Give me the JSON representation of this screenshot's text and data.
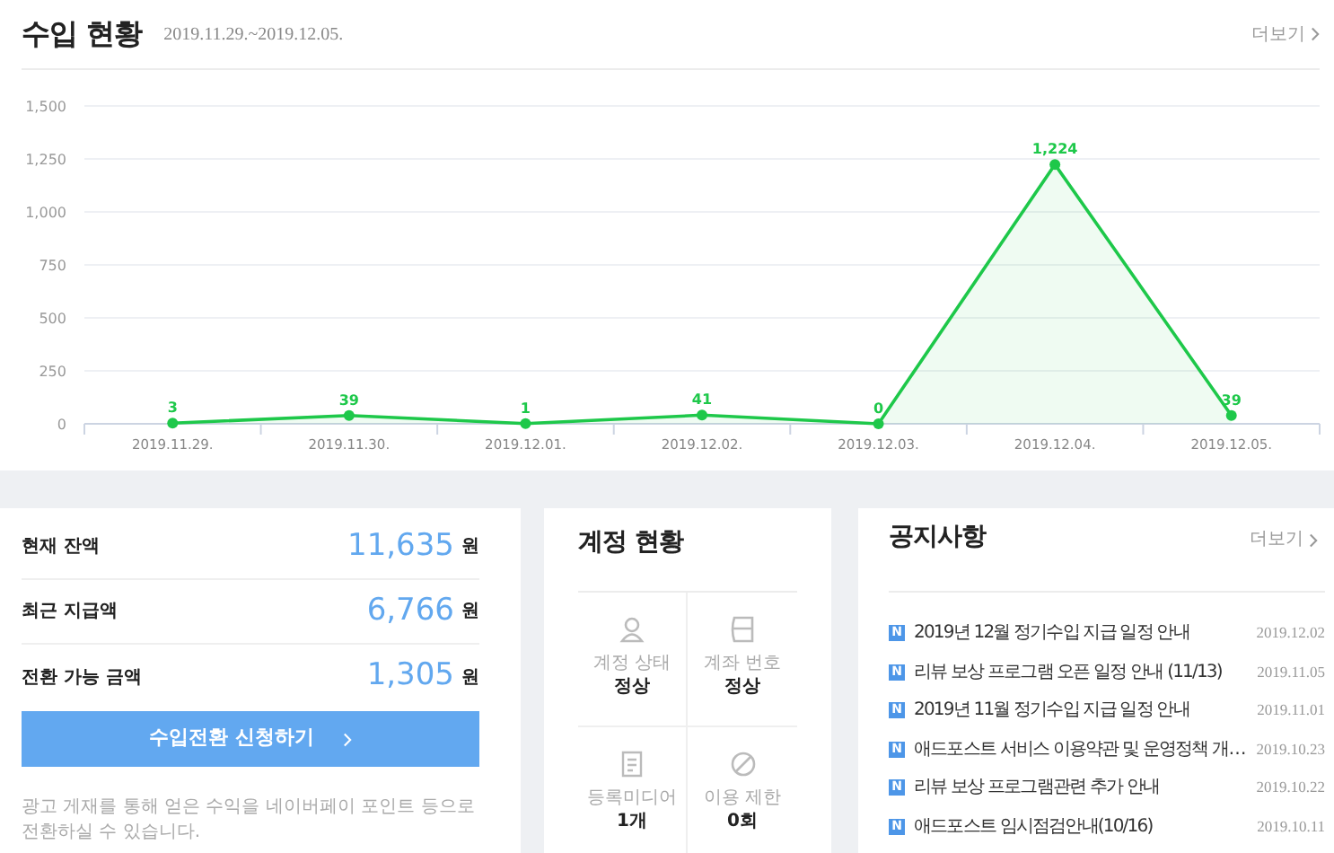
{
  "header": {
    "title": "수입 현황",
    "period": "2019.11.29.~2019.12.05.",
    "more": "더보기"
  },
  "chart_data": {
    "type": "area",
    "categories": [
      "2019.11.29.",
      "2019.11.30.",
      "2019.12.01.",
      "2019.12.02.",
      "2019.12.03.",
      "2019.12.04.",
      "2019.12.05."
    ],
    "series": [
      {
        "color": "#1ec84a",
        "values": [
          3,
          39,
          1,
          41,
          0,
          1224,
          39
        ]
      }
    ],
    "ylim": [
      0,
      1500
    ],
    "yticks": [
      {
        "value": 0,
        "label": "0"
      },
      {
        "value": 250,
        "label": "250"
      },
      {
        "value": 500,
        "label": "500"
      },
      {
        "value": 750,
        "label": "750"
      },
      {
        "value": 1000,
        "label": "1,000"
      },
      {
        "value": 1250,
        "label": "1,250"
      },
      {
        "value": 1500,
        "label": "1,500"
      }
    ],
    "value_labels": [
      "3",
      "39",
      "1",
      "41",
      "0",
      "1,224",
      "39"
    ],
    "grid": true
  },
  "balance": {
    "rows": [
      {
        "label": "현재 잔액",
        "amount": "11,635",
        "unit": "원"
      },
      {
        "label": "최근 지급액",
        "amount": "6,766",
        "unit": "원"
      },
      {
        "label": "전환 가능 금액",
        "amount": "1,305",
        "unit": "원"
      }
    ],
    "button": "수입전환 신청하기",
    "note": "광고 게재를 통해 얻은 수익을 네이버페이 포인트 등으로 전환하실 수 있습니다."
  },
  "account": {
    "title": "계정 현황",
    "items": [
      {
        "kind": "person",
        "label": "계정 상태",
        "value": "정상"
      },
      {
        "kind": "card",
        "label": "계좌 번호",
        "value": "정상"
      },
      {
        "kind": "document",
        "label": "등록미디어",
        "value": "1개"
      },
      {
        "kind": "ban",
        "label": "이용 제한",
        "value": "0회"
      }
    ]
  },
  "notices": {
    "title": "공지사항",
    "more": "더보기",
    "items": [
      {
        "badge": "N",
        "title": "2019년 12월 정기수입 지급 일정 안내",
        "date": "2019.12.02"
      },
      {
        "badge": "N",
        "title": "리뷰 보상 프로그램 오픈 일정 안내 (11/13)",
        "date": "2019.11.05"
      },
      {
        "badge": "N",
        "title": "2019년 11월 정기수입 지급 일정 안내",
        "date": "2019.11.01"
      },
      {
        "badge": "N",
        "title": "애드포스트 서비스 이용약관 및 운영정책 개…",
        "date": "2019.10.23"
      },
      {
        "badge": "N",
        "title": "리뷰 보상 프로그램관련 추가 안내",
        "date": "2019.10.22"
      },
      {
        "badge": "N",
        "title": "애드포스트 임시점검안내(10/16)",
        "date": "2019.10.11"
      }
    ]
  }
}
